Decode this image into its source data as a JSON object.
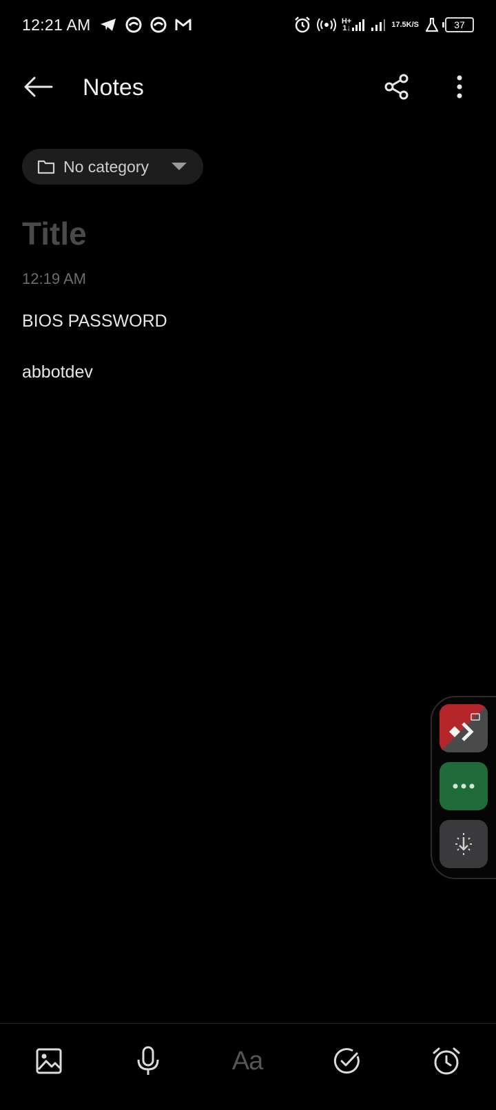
{
  "status_bar": {
    "time": "12:21 AM",
    "network_type": "H+",
    "network_sub": "1↓",
    "speed_value": "17.5",
    "speed_unit": "K/S",
    "battery": "37"
  },
  "app_bar": {
    "title": "Notes"
  },
  "category": {
    "label": "No category"
  },
  "note": {
    "title_placeholder": "Title",
    "timestamp": "12:19 AM",
    "lines": [
      "BIOS PASSWORD",
      "abbotdev"
    ]
  },
  "bottom_toolbar": {
    "text_style_label": "Aa"
  },
  "colors": {
    "background": "#000000",
    "anydesk_red": "#b5262b",
    "chat_green": "#1f6b3a"
  }
}
